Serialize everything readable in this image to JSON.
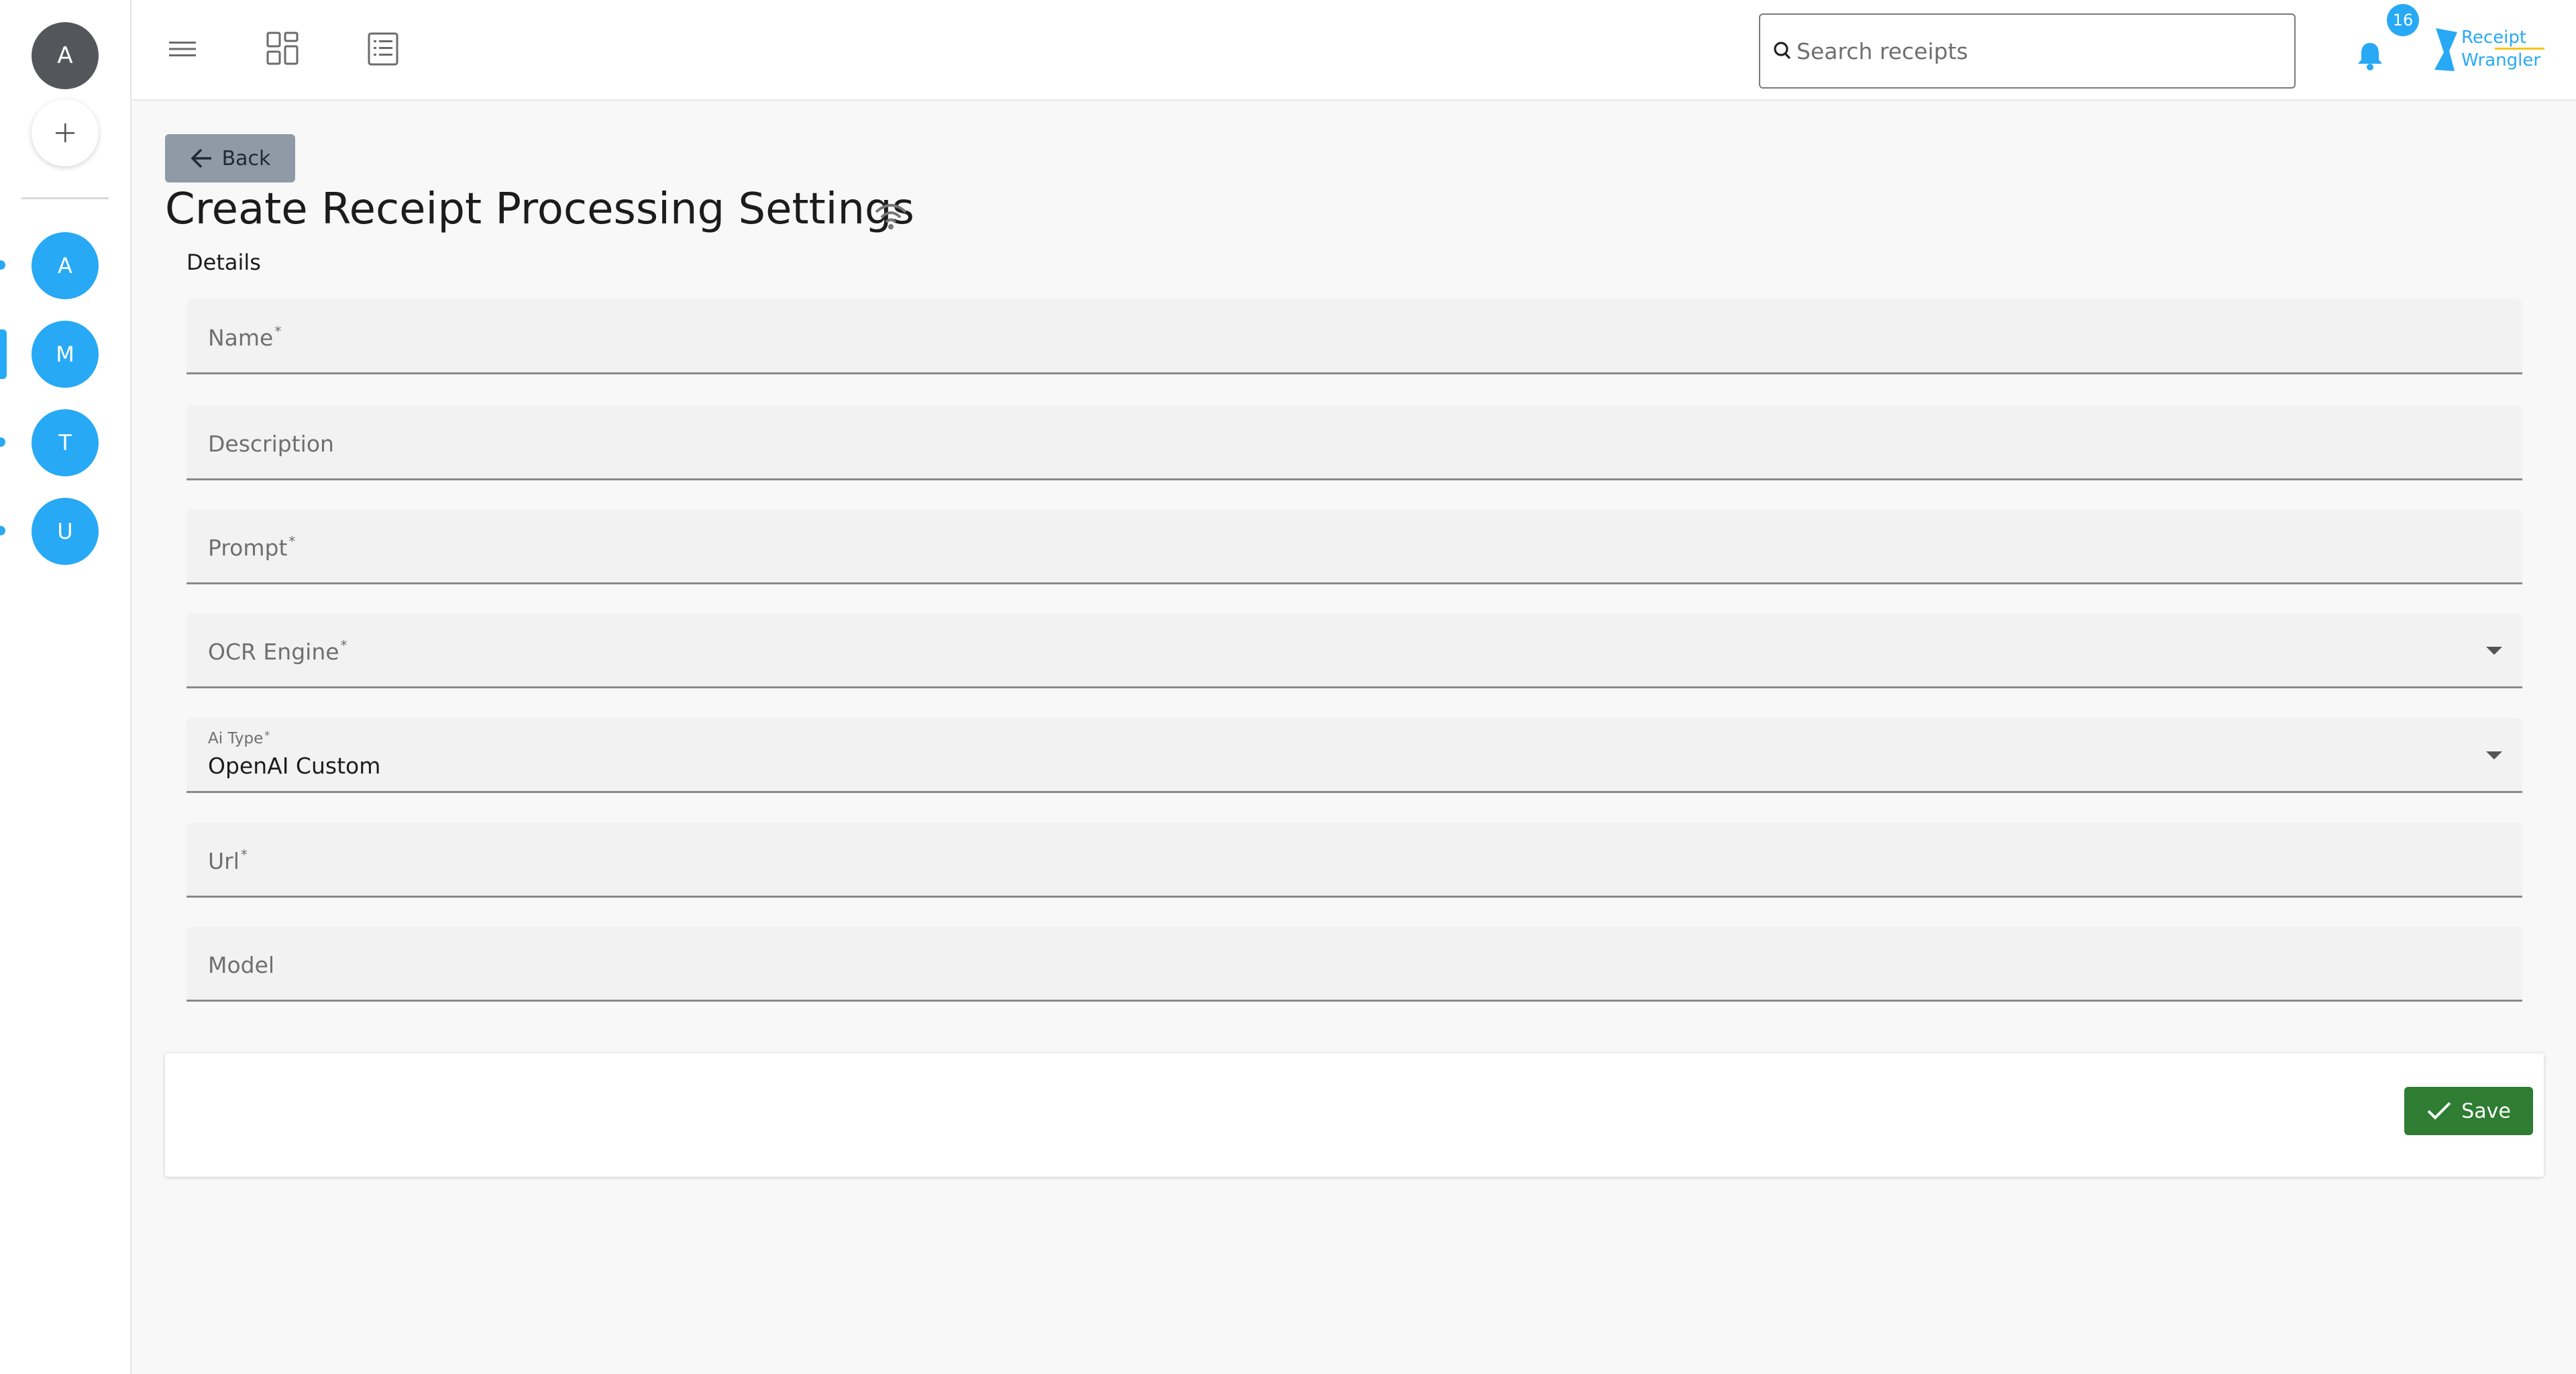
{
  "sidebar": {
    "user_initial": "A",
    "groups": [
      {
        "initial": "A"
      },
      {
        "initial": "M"
      },
      {
        "initial": "T"
      },
      {
        "initial": "U"
      }
    ]
  },
  "header": {
    "search_placeholder": "Search receipts",
    "notification_count": "16",
    "logo_line1": "Receipt",
    "logo_line2": "Wrangler"
  },
  "page": {
    "back_label": "Back",
    "title": "Create Receipt Processing Settings",
    "section_label": "Details"
  },
  "form": {
    "name_label": "Name",
    "description_label": "Description",
    "prompt_label": "Prompt",
    "ocr_engine_label": "OCR Engine",
    "ai_type_label": "Ai Type",
    "ai_type_value": "OpenAI Custom",
    "url_label": "Url",
    "model_label": "Model",
    "required_mark": "*"
  },
  "actions": {
    "save_label": "Save"
  },
  "colors": {
    "accent": "#27a9f5",
    "save": "#2e7d32",
    "back": "#8e9aa6"
  }
}
